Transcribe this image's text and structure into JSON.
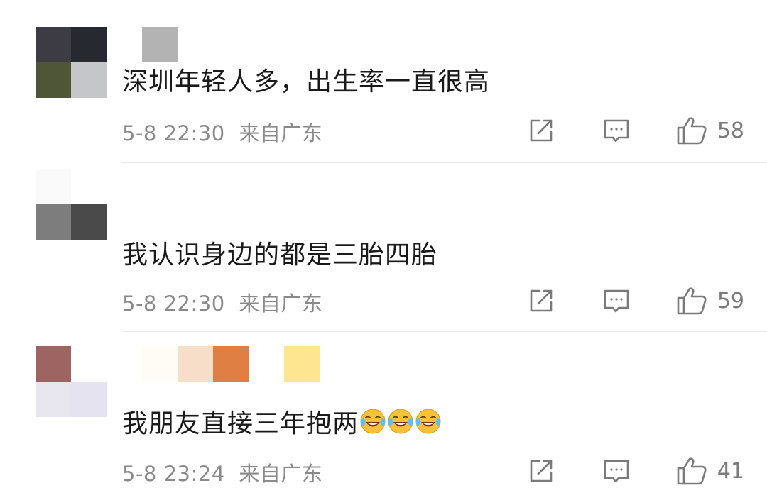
{
  "comments": [
    {
      "avatar_colors": [
        "#3d3b44",
        "#262a30",
        "#4f5638",
        "#c5c6c8"
      ],
      "nickname_colors": [
        "#b3b3b3"
      ],
      "text": "深圳年轻人多，出生率一直很高",
      "time": "5-8 22:30",
      "location": "来自广东",
      "likes": "58"
    },
    {
      "avatar_colors": [
        "#fafafa",
        "#4a4a4a",
        "#7d7d7d",
        "#ffffff"
      ],
      "nickname_colors": [],
      "text": "我认识身边的都是三胎四胎",
      "time": "5-8 22:30",
      "location": "来自广东",
      "likes": "59"
    },
    {
      "avatar_colors": [
        "#9e6461",
        "#ffffff",
        "#e7e5ee",
        "#e4e3ef"
      ],
      "nickname_colors": [
        "#fffcf6",
        "#f6dfc8",
        "#e07f44",
        "#ffffff",
        "#fde68f"
      ],
      "text": "我朋友直接三年抱两",
      "emoji": [
        "laughing-crying-emoji",
        "laughing-crying-emoji",
        "laughing-crying-emoji"
      ],
      "time": "5-8 23:24",
      "location": "来自广东",
      "likes": "41"
    }
  ],
  "icons": {
    "share": "share-icon",
    "reply": "comment-icon",
    "like": "thumbs-up-icon"
  },
  "colors": {
    "text": "#1a1a1a",
    "meta": "#8a8a8a",
    "divider": "#e8e8e8"
  }
}
